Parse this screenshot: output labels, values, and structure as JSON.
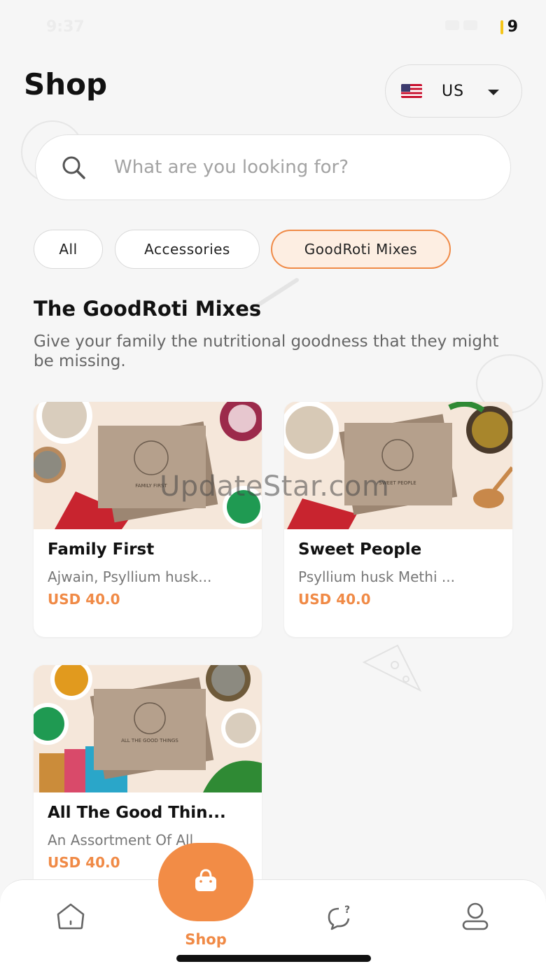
{
  "status": {
    "time": "9:37",
    "battery": "9"
  },
  "header": {
    "title": "Shop"
  },
  "region": {
    "label": "US",
    "flag": "us-flag-icon"
  },
  "search": {
    "placeholder": "What are you looking for?"
  },
  "filters": [
    {
      "label": "All",
      "active": false
    },
    {
      "label": "Accessories",
      "active": false
    },
    {
      "label": "GoodRoti Mixes",
      "active": true
    }
  ],
  "section": {
    "title": "The GoodRoti Mixes",
    "subtitle": "Give your family the nutritional goodness that they might be missing."
  },
  "products": [
    {
      "name": "Family First",
      "description": "Ajwain, Psyllium husk...",
      "price": "USD 40.0",
      "box_label": "FAMILY FIRST"
    },
    {
      "name": "Sweet People",
      "description": "Psyllium husk Methi ...",
      "price": "USD 40.0",
      "box_label": "SWEET PEOPLE"
    },
    {
      "name": "All The Good Thin...",
      "description": "An Assortment Of All ...",
      "price": "USD 40.0",
      "box_label": "ALL THE GOOD THINGS"
    }
  ],
  "watermark": "UpdateStar.com",
  "nav": {
    "items": [
      {
        "icon": "home-icon"
      },
      {
        "icon": "shopping-bag-icon",
        "label": "Shop"
      },
      {
        "icon": "chat-help-icon"
      },
      {
        "icon": "profile-icon"
      }
    ]
  },
  "colors": {
    "accent": "#f28c46",
    "accent_text": "#f08a46",
    "chip_active_bg": "#fdeee2"
  }
}
